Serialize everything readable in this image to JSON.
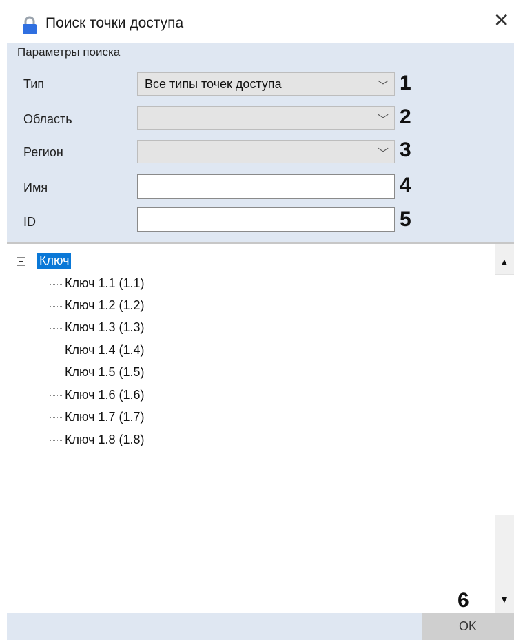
{
  "window": {
    "title": "Поиск точки доступа",
    "close_icon": "close-icon",
    "lock_icon": "lock-icon",
    "lock_color": "#1a73e8"
  },
  "params": {
    "group_label": "Параметры поиска",
    "type_label": "Тип",
    "type_value": "Все типы точек доступа",
    "area_label": "Область",
    "area_value": "",
    "region_label": "Регион",
    "region_value": "",
    "name_label": "Имя",
    "name_value": "",
    "id_label": "ID",
    "id_value": ""
  },
  "markers": [
    "1",
    "2",
    "3",
    "4",
    "5",
    "6"
  ],
  "tree": {
    "root": "Ключ",
    "items": [
      "Ключ 1.1 (1.1)",
      "Ключ 1.2 (1.2)",
      "Ключ 1.3 (1.3)",
      "Ключ 1.4 (1.4)",
      "Ключ 1.5 (1.5)",
      "Ключ 1.6 (1.6)",
      "Ключ 1.7 (1.7)",
      "Ключ 1.8 (1.8)"
    ]
  },
  "footer": {
    "ok_label": "OK"
  },
  "colors": {
    "panel_bg": "#dfe7f2",
    "selection": "#0a78d7"
  }
}
